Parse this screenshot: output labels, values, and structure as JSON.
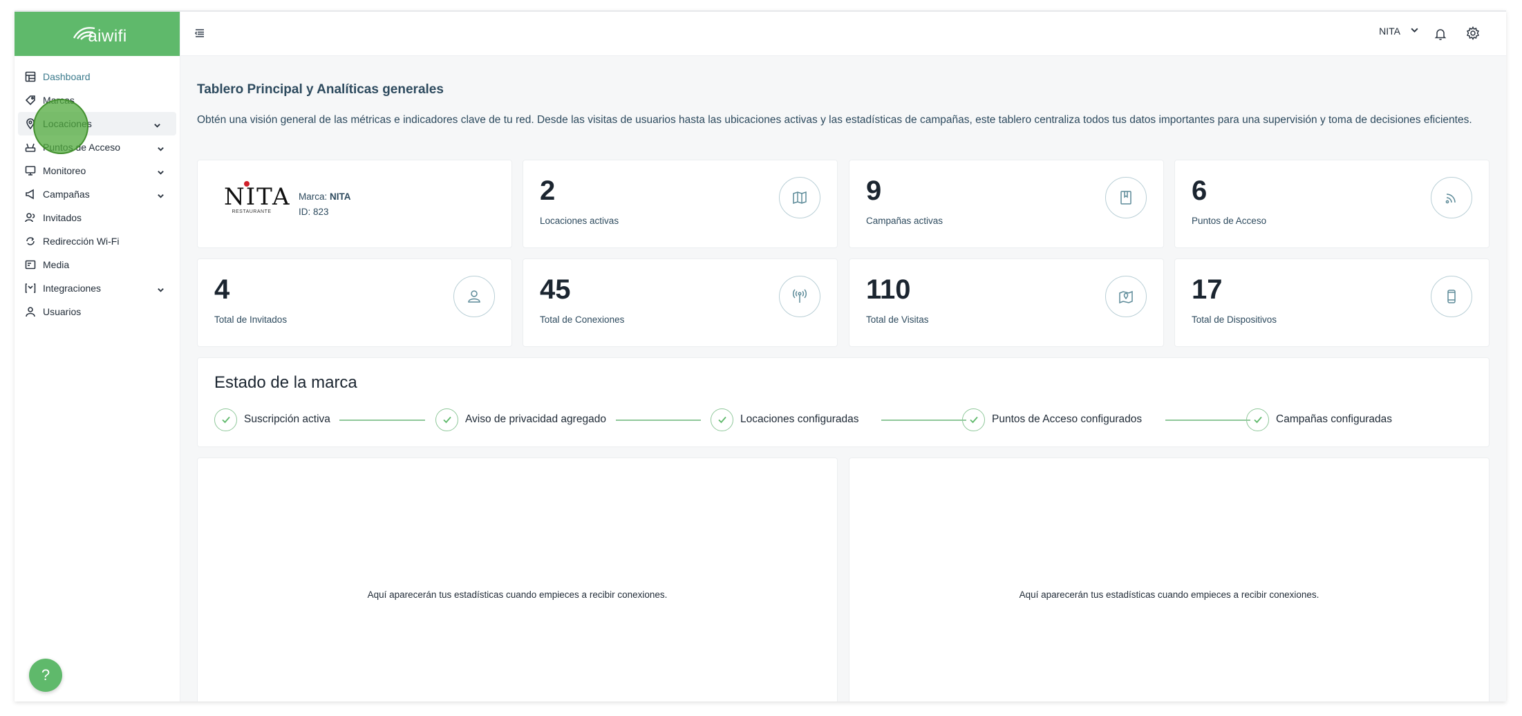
{
  "app": {
    "brand_name": "aiwifi",
    "help_label": "?"
  },
  "sidebar": {
    "items": [
      {
        "label": "Dashboard",
        "icon": "dashboard-icon",
        "has_submenu": false
      },
      {
        "label": "Marcas",
        "icon": "tag-icon",
        "has_submenu": false
      },
      {
        "label": "Locaciones",
        "icon": "location-pin-icon",
        "has_submenu": true
      },
      {
        "label": "Puntos de Acceso",
        "icon": "router-icon",
        "has_submenu": true
      },
      {
        "label": "Monitoreo",
        "icon": "monitor-icon",
        "has_submenu": true
      },
      {
        "label": "Campañas",
        "icon": "megaphone-icon",
        "has_submenu": true
      },
      {
        "label": "Invitados",
        "icon": "guests-icon",
        "has_submenu": false
      },
      {
        "label": "Redirección Wi-Fi",
        "icon": "redirect-icon",
        "has_submenu": false
      },
      {
        "label": "Media",
        "icon": "media-icon",
        "has_submenu": false
      },
      {
        "label": "Integraciones",
        "icon": "integrations-icon",
        "has_submenu": true
      },
      {
        "label": "Usuarios",
        "icon": "user-icon",
        "has_submenu": false
      }
    ]
  },
  "topbar": {
    "user_name": "NITA"
  },
  "page": {
    "title": "Tablero Principal y Analíticas generales",
    "description": "Obtén una visión general de las métricas e indicadores clave de tu red. Desde las visitas de usuarios hasta las ubicaciones activas y las estadísticas de campañas, este tablero centraliza todos tus datos importantes para una supervisión y toma de decisiones eficientes."
  },
  "brand_card": {
    "logo_text": "NITA",
    "logo_subtext": "RESTAURANTE",
    "brand_label": "Marca:",
    "brand_value": "NITA",
    "id_label": "ID:",
    "id_value": "823"
  },
  "stats": [
    {
      "value": "2",
      "label": "Locaciones activas",
      "icon": "map-icon"
    },
    {
      "value": "9",
      "label": "Campañas activas",
      "icon": "bookmark-icon"
    },
    {
      "value": "6",
      "label": "Puntos de Acceso",
      "icon": "wifi-signal-icon"
    },
    {
      "value": "4",
      "label": "Total de Invitados",
      "icon": "person-icon"
    },
    {
      "value": "45",
      "label": "Total de Conexiones",
      "icon": "antenna-icon"
    },
    {
      "value": "110",
      "label": "Total de Visitas",
      "icon": "map-pin-icon"
    },
    {
      "value": "17",
      "label": "Total de Dispositivos",
      "icon": "mobile-device-icon"
    }
  ],
  "brand_status": {
    "title": "Estado de la marca",
    "steps": [
      "Suscripción activa",
      "Aviso de privacidad agregado",
      "Locaciones configuradas",
      "Puntos de Acceso configurados",
      "Campañas configuradas"
    ]
  },
  "panels": [
    {
      "empty_message": "Aquí aparecerán tus estadísticas cuando empieces a recibir conexiones."
    },
    {
      "empty_message": "Aquí aparecerán tus estadísticas cuando empieces a recibir conexiones."
    }
  ],
  "colors": {
    "brand_green": "#5fb96b",
    "text_dark": "#1b2530",
    "text_blue": "#2d4a5e",
    "icon_ring": "#b9cfd6"
  }
}
